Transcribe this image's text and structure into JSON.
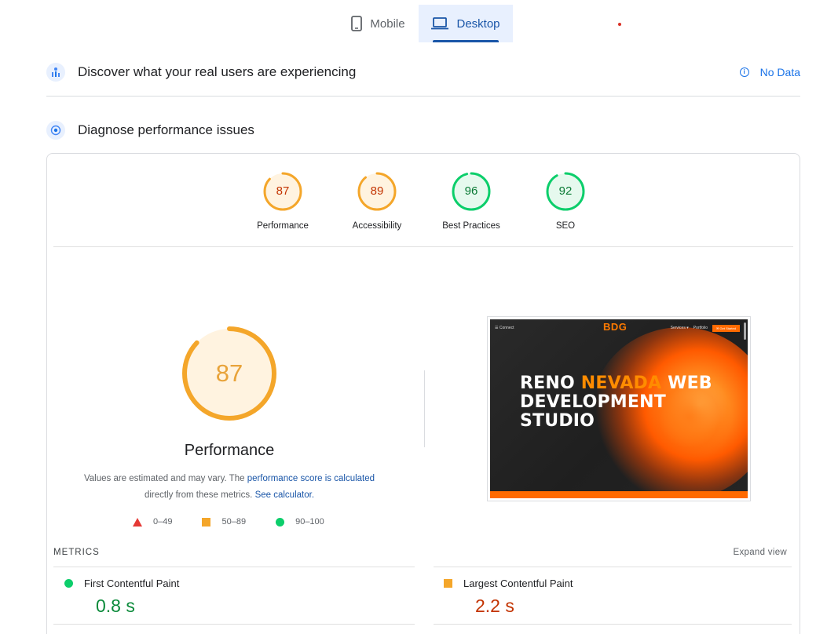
{
  "tabs": {
    "mobile_label": "Mobile",
    "desktop_label": "Desktop"
  },
  "crux": {
    "title": "Discover what your real users are experiencing",
    "no_data_label": "No Data"
  },
  "diagnose": {
    "title": "Diagnose performance issues"
  },
  "categories": [
    {
      "score": "87",
      "label": "Performance",
      "color": "#f4a62a",
      "status": "average"
    },
    {
      "score": "89",
      "label": "Accessibility",
      "color": "#f4a62a",
      "status": "average"
    },
    {
      "score": "96",
      "label": "Best Practices",
      "color": "#0cce6b",
      "status": "pass"
    },
    {
      "score": "92",
      "label": "SEO",
      "color": "#0cce6b",
      "status": "pass"
    }
  ],
  "performance": {
    "score": "87",
    "score_fraction": 0.87,
    "label": "Performance",
    "note_prefix": "Values are estimated and may vary. The ",
    "note_link1": "performance score is calculated",
    "note_middle": "directly from these metrics. ",
    "note_link2": "See calculator.",
    "legend": {
      "fail": "0–49",
      "average": "50–89",
      "pass": "90–100"
    }
  },
  "screenshot": {
    "nav_left": "☰ Connect",
    "logo": "BDG",
    "nav_services": "Services ▾",
    "nav_portfolio": "Portfolio",
    "nav_button": "✉ Get Started",
    "headline_1a": "RENO ",
    "headline_1b": "NEVADA",
    "headline_1c": " WEB",
    "headline_2": "DEVELOPMENT",
    "headline_3": "STUDIO"
  },
  "metrics": {
    "header": "METRICS",
    "expand_label": "Expand view",
    "items": [
      {
        "name": "First Contentful Paint",
        "value": "0.8 s",
        "status": "pass"
      },
      {
        "name": "Largest Contentful Paint",
        "value": "2.2 s",
        "status": "average"
      }
    ]
  },
  "colors": {
    "average": "#f4a62a",
    "pass": "#0cce6b",
    "fail": "#e53935",
    "accent": "#1a56a8"
  }
}
